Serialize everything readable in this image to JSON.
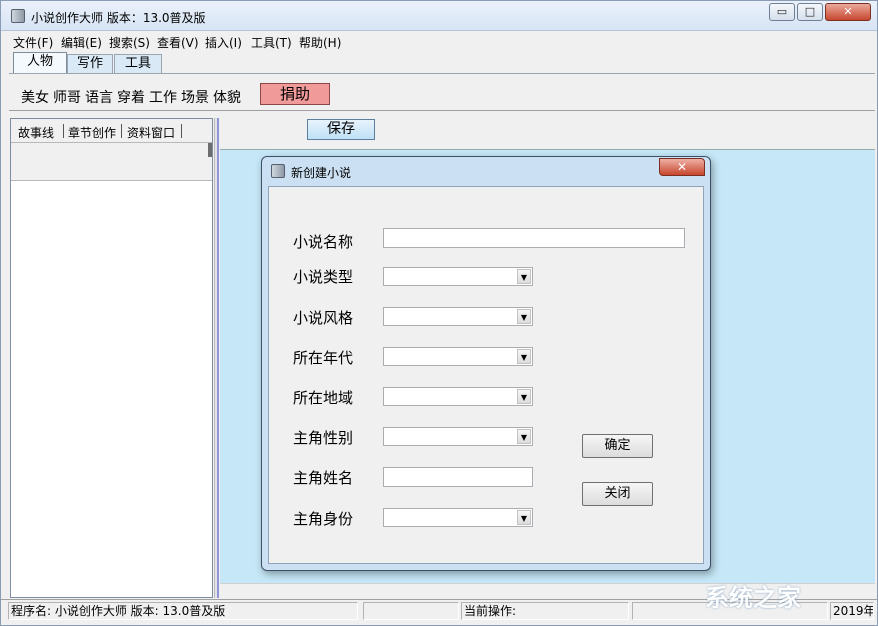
{
  "window": {
    "title": "小说创作大师 版本：13.0普及版",
    "caption_buttons": {
      "minimize": "▭",
      "maximize": "□",
      "close": "✕"
    }
  },
  "menu": [
    "文件(F)",
    "编辑(E)",
    "搜索(S)",
    "查看(V)",
    "插入(I)",
    "工具(T)",
    "帮助(H)"
  ],
  "top_tabs": [
    "人物",
    "写作",
    "工具"
  ],
  "toolbar_links": [
    "美女",
    "师哥",
    "语言",
    "穿着",
    "工作",
    "场景",
    "体貌"
  ],
  "donate_label": "捐助",
  "left_tabs": [
    "故事线",
    "章节创作",
    "资料窗口"
  ],
  "save_label": "保存",
  "status": {
    "program": "程序名: 小说创作大师  版本: 13.0普及版",
    "current_op": "当前操作:",
    "year": "2019年"
  },
  "dialog": {
    "title": "新创建小说",
    "close_label": "✕",
    "fields": [
      {
        "label": "小说名称",
        "type": "text",
        "value": ""
      },
      {
        "label": "小说类型",
        "type": "combo",
        "value": ""
      },
      {
        "label": "小说风格",
        "type": "combo",
        "value": ""
      },
      {
        "label": "所在年代",
        "type": "combo",
        "value": ""
      },
      {
        "label": "所在地域",
        "type": "combo",
        "value": ""
      },
      {
        "label": "主角性别",
        "type": "combo",
        "value": ""
      },
      {
        "label": "主角姓名",
        "type": "text",
        "value": ""
      },
      {
        "label": "主角身份",
        "type": "combo",
        "value": ""
      }
    ],
    "ok_label": "确定",
    "close_button_label": "关闭"
  },
  "watermark": "系统之家",
  "colors": {
    "workspace_bg": "#c5e7f7",
    "donate_bg": "#f19a9a",
    "dialog_frame": "#cbe0f2"
  }
}
